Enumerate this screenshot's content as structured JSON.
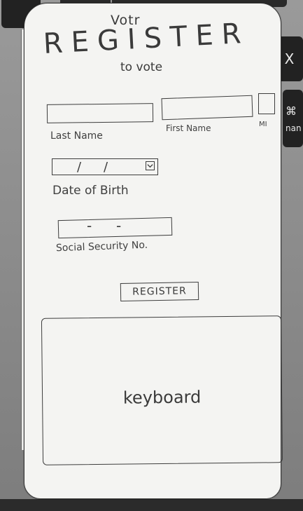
{
  "app": {
    "name": "Votr",
    "title": "REGISTER",
    "subtitle": "to vote"
  },
  "form": {
    "last_name_label": "Last Name",
    "first_name_label": "First Name",
    "mi_label": "MI",
    "dob": {
      "separator": "/",
      "label": "Date of Birth",
      "icon": "dropdown-icon"
    },
    "ssn": {
      "separator": "-",
      "label": "Social Security No."
    },
    "register_button": "REGISTER"
  },
  "keyboard": {
    "label": "keyboard"
  },
  "background_keys": {
    "x_key": "X",
    "cmd_symbol": "⌘",
    "cmd_word": "nan"
  },
  "colors": {
    "paper": "#f4f4f2",
    "ink": "#3a3a3a",
    "laptop": "#8e8e8e"
  }
}
